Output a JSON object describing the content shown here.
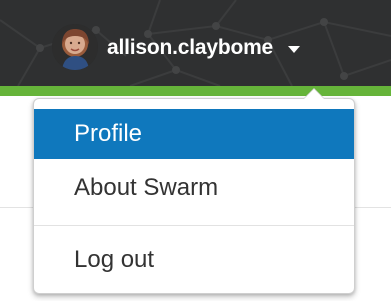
{
  "header": {
    "username": "allison.claybome",
    "avatar_icon": "user-avatar",
    "caret_icon": "chevron-down-icon",
    "background_color": "#2f3031",
    "accent_strip_color": "#66b43a"
  },
  "menu": {
    "items": [
      {
        "label": "Profile",
        "state": "active"
      },
      {
        "label": "About Swarm",
        "state": "normal"
      },
      {
        "label": "Log out",
        "state": "normal"
      }
    ],
    "active_background_color": "#0f78bd"
  }
}
